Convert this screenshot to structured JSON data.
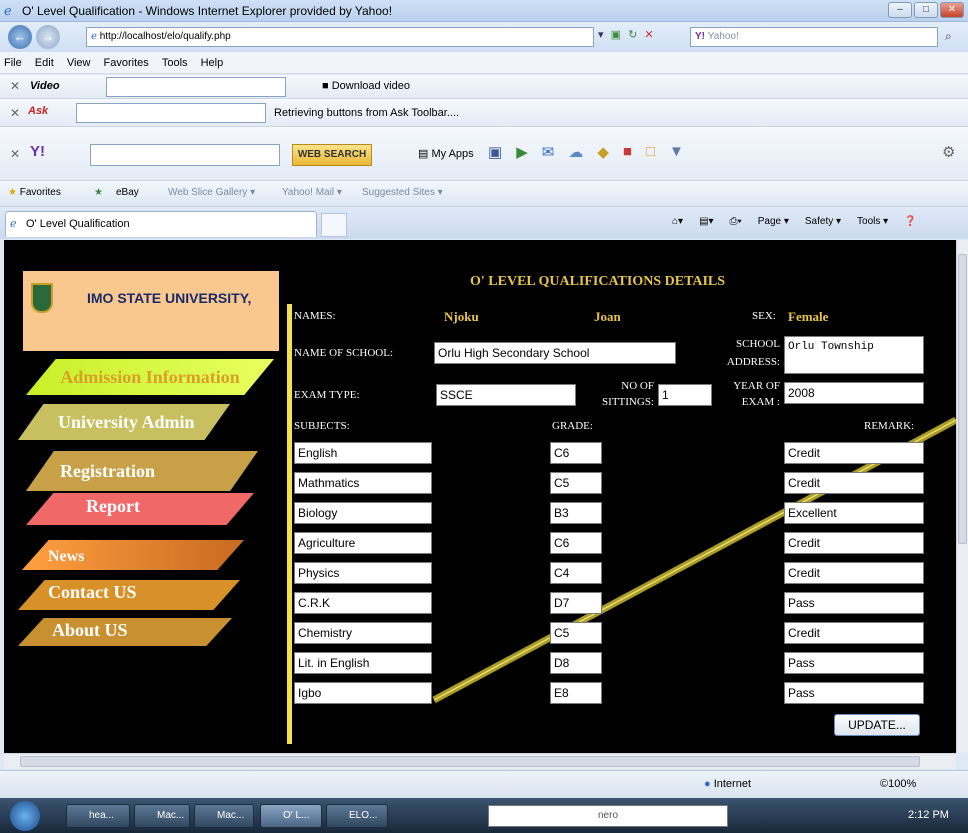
{
  "window": {
    "title": "O' Level Qualification - Windows Internet Explorer provided by Yahoo!"
  },
  "address": {
    "url": "http://localhost/elo/qualify.php",
    "search_placeholder": "Yahoo!"
  },
  "menu": [
    "File",
    "Edit",
    "View",
    "Favorites",
    "Tools",
    "Help"
  ],
  "toolbars": {
    "video_label": "Video",
    "download_video": "Download video",
    "ask_status": "Retrieving buttons from Ask Toolbar....",
    "web_search": "WEB SEARCH",
    "my_apps": "My Apps"
  },
  "favorites": {
    "label": "Favorites",
    "items": [
      "eBay",
      "Web Slice Gallery ▾",
      "Yahoo! Mail ▾",
      "Suggested Sites ▾"
    ]
  },
  "tab": {
    "title": "O' Level Qualification"
  },
  "cmdbar": [
    "Page ▾",
    "Safety ▾",
    "Tools ▾"
  ],
  "sidebar": {
    "logo_text": "IMO STATE UNIVERSITY,",
    "nav": [
      "Admission Information",
      "University Admin",
      "Registration",
      "Report",
      "News",
      "Contact US",
      "About US"
    ]
  },
  "form": {
    "heading": "O' LEVEL QUALIFICATIONS DETAILS",
    "names_label": "NAMES:",
    "surname": "Njoku",
    "firstname": "Joan",
    "sex_label": "SEX:",
    "sex": "Female",
    "school_label": "NAME OF SCHOOL:",
    "school": "Orlu High Secondary School",
    "school_address_label_1": "SCHOOL",
    "school_address_label_2": "ADDRESS:",
    "school_address": "Orlu Township",
    "exam_type_label": "EXAM TYPE:",
    "exam_type": "SSCE",
    "sittings_label_1": "NO OF",
    "sittings_label_2": "SITTINGS:",
    "sittings": "1",
    "year_label_1": "YEAR OF",
    "year_label_2": "EXAM :",
    "year": "2008",
    "col_subjects": "SUBJECTS:",
    "col_grade": "GRADE:",
    "col_remark": "REMARK:",
    "rows": [
      {
        "subject": "English",
        "grade": "C6",
        "remark": "Credit"
      },
      {
        "subject": "Mathmatics",
        "grade": "C5",
        "remark": "Credit"
      },
      {
        "subject": "Biology",
        "grade": "B3",
        "remark": "Excellent"
      },
      {
        "subject": "Agriculture",
        "grade": "C6",
        "remark": "Credit"
      },
      {
        "subject": "Physics",
        "grade": "C4",
        "remark": "Credit"
      },
      {
        "subject": "C.R.K",
        "grade": "D7",
        "remark": "Pass"
      },
      {
        "subject": "Chemistry",
        "grade": "C5",
        "remark": "Credit"
      },
      {
        "subject": "Lit. in English",
        "grade": "D8",
        "remark": "Pass"
      },
      {
        "subject": "Igbo",
        "grade": "E8",
        "remark": "Pass"
      }
    ],
    "update_button": "UPDATE..."
  },
  "status": {
    "zone": "Internet",
    "zoom": "©100%"
  },
  "taskbar": {
    "items": [
      "hea...",
      "Mac...",
      "Mac...",
      "O' L...",
      "ELO..."
    ],
    "search_brand": "nero",
    "time": "2:12 PM"
  },
  "colors": {
    "page_bg": "#000000",
    "accent_yellow": "#e8c54a",
    "nav_peach": "#f9c88f"
  }
}
